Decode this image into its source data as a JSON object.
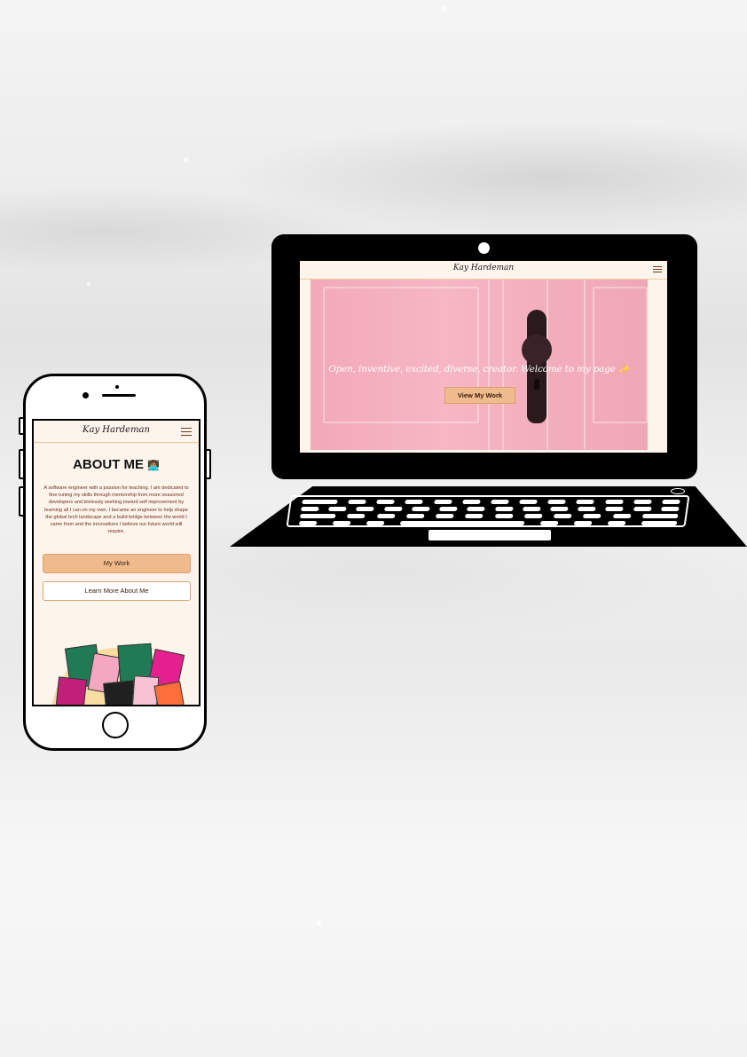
{
  "laptop": {
    "site": {
      "logo": "Kay Hardeman",
      "menu_icon": "hamburger-menu-icon",
      "hero_tagline": "Open, inventive, excited, diverse, creator. Welcome to my page ✨",
      "cta_label": "View My Work"
    }
  },
  "phone": {
    "site": {
      "logo": "Kay Hardeman",
      "menu_icon": "hamburger-menu-icon",
      "about_title": "ABOUT ME",
      "about_emoji": "👩🏽‍💻",
      "about_text": "A software engineer with a passion for teaching. I am dedicated to fine-tuning my skills through mentorship from more seasoned developers and tirelessly working toward self improvement by learning all I can on my own. I became an engineer to help shape the global tech landscape and a build bridge between the world I came from and the innovations I believe our future world will require.",
      "primary_button": "My Work",
      "secondary_button": "Learn More About Me"
    }
  },
  "colors": {
    "accent": "#efbb8c",
    "site_background": "#fdf4ec",
    "text_brown": "#6b2e1c",
    "hero_pink": "#f6b6c4",
    "device_frame": "#000000"
  }
}
